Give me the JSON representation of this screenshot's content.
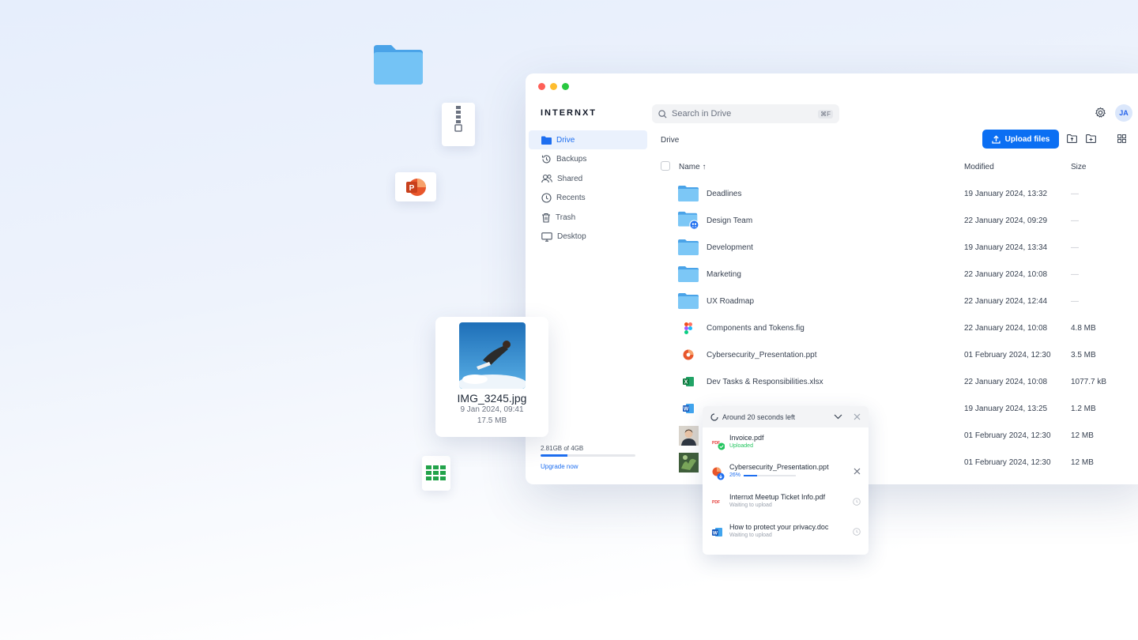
{
  "floating": {
    "image_card": {
      "name": "IMG_3245.jpg",
      "date": "9 Jan 2024, 09:41",
      "size": "17.5 MB"
    }
  },
  "app": {
    "logo": "INTERNXT",
    "search": {
      "placeholder": "Search in Drive",
      "shortcut": "⌘F"
    },
    "avatar": "JA",
    "sidebar": {
      "items": [
        {
          "label": "Drive",
          "icon": "folder-icon",
          "active": true
        },
        {
          "label": "Backups",
          "icon": "history-icon"
        },
        {
          "label": "Shared",
          "icon": "users-icon"
        },
        {
          "label": "Recents",
          "icon": "clock-icon"
        },
        {
          "label": "Trash",
          "icon": "trash-icon"
        },
        {
          "label": "Desktop",
          "icon": "monitor-icon"
        }
      ],
      "storage": {
        "usage": "2.81GB of 4GB",
        "fraction": 0.28,
        "upgrade": "Upgrade now"
      }
    },
    "breadcrumb": "Drive",
    "upload_button": "Upload files",
    "columns": {
      "name": "Name ↑",
      "modified": "Modified",
      "size": "Size"
    },
    "files": [
      {
        "name": "Deadlines",
        "modified": "19 January 2024, 13:32",
        "size": "—",
        "type": "folder"
      },
      {
        "name": "Design Team",
        "modified": "22 January 2024, 09:29",
        "size": "—",
        "type": "shared-folder"
      },
      {
        "name": "Development",
        "modified": "19 January 2024, 13:34",
        "size": "—",
        "type": "folder"
      },
      {
        "name": "Marketing",
        "modified": "22 January 2024, 10:08",
        "size": "—",
        "type": "folder"
      },
      {
        "name": "UX Roadmap",
        "modified": "22 January 2024, 12:44",
        "size": "—",
        "type": "folder"
      },
      {
        "name": "Components and Tokens.fig",
        "modified": "22 January 2024, 10:08",
        "size": "4.8 MB",
        "type": "figma"
      },
      {
        "name": "Cybersecurity_Presentation.ppt",
        "modified": "01 February 2024, 12:30",
        "size": "3.5 MB",
        "type": "ppt"
      },
      {
        "name": "Dev Tasks & Responsibilities.xlsx",
        "modified": "22 January 2024, 10:08",
        "size": "1077.7 kB",
        "type": "xlsx"
      },
      {
        "name": "",
        "modified": "19 January 2024, 13:25",
        "size": "1.2 MB",
        "type": "word"
      },
      {
        "name": "",
        "modified": "01 February 2024, 12:30",
        "size": "12 MB",
        "type": "photo-person"
      },
      {
        "name": "",
        "modified": "01 February 2024, 12:30",
        "size": "12 MB",
        "type": "photo-plant"
      }
    ],
    "upload_panel": {
      "title": "Around 20 seconds left",
      "items": [
        {
          "name": "Invoice.pdf",
          "status": "Uploaded",
          "type": "pdf"
        },
        {
          "name": "Cybersecurity_Presentation.ppt",
          "status": "26%",
          "progress": 0.26,
          "type": "ppt"
        },
        {
          "name": "Internxt Meetup Ticket Info.pdf",
          "status": "Waiting to upload",
          "type": "pdf"
        },
        {
          "name": "How to protect your privacy.doc",
          "status": "Waiting to upload",
          "type": "word"
        }
      ]
    },
    "colors": {
      "accent": "#0b6ff3",
      "folder": "#5bb4ef",
      "traffic_red": "#fe5f57",
      "traffic_yellow": "#febc2e",
      "traffic_green": "#28c840"
    }
  }
}
